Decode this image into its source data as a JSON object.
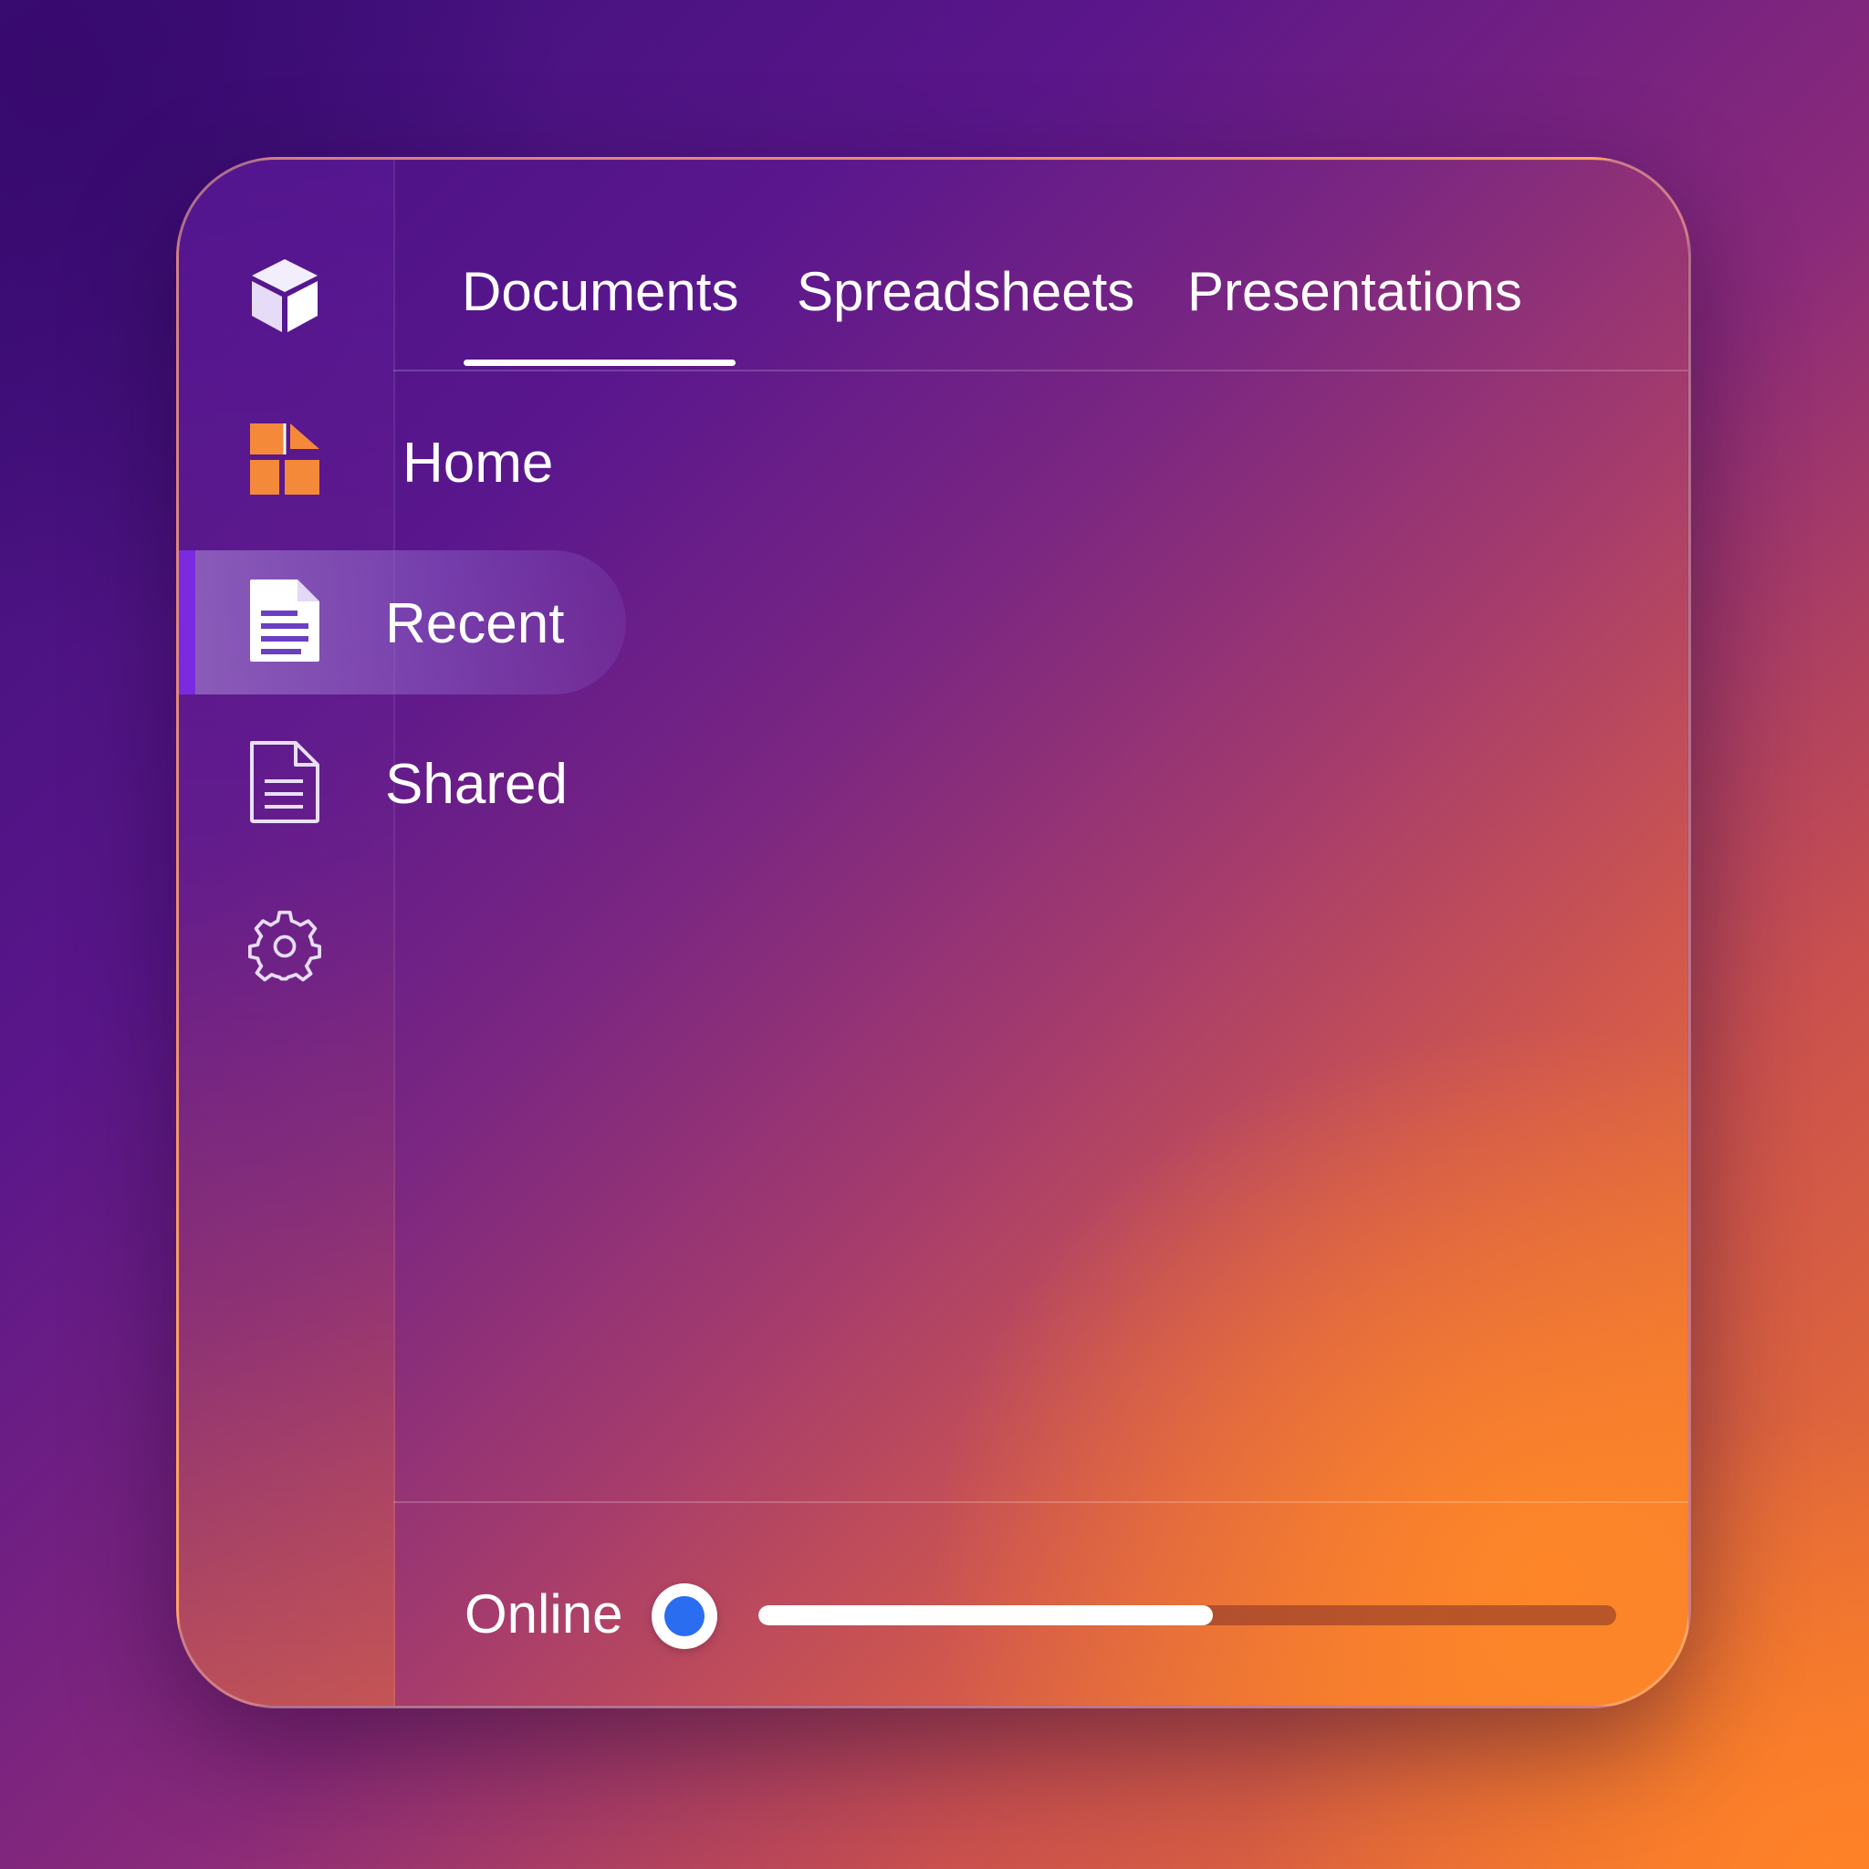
{
  "tabs": [
    {
      "label": "Documents",
      "active": true
    },
    {
      "label": "Spreadsheets",
      "active": false
    },
    {
      "label": "Presentations",
      "active": false
    }
  ],
  "sidebar": {
    "logo_icon": "cube-icon",
    "items": [
      {
        "label": "Home",
        "icon": "home-grid-icon",
        "selected": false
      },
      {
        "label": "Recent",
        "icon": "document-filled-icon",
        "selected": true
      },
      {
        "label": "Shared",
        "icon": "document-outline-icon",
        "selected": false
      }
    ],
    "settings_icon": "gear-icon"
  },
  "footer": {
    "status_label": "Online",
    "status_dot_color": "#2a6df0",
    "progress": 0.53
  },
  "colors": {
    "accent": "#7a2be0",
    "home_icon": "#f5893a",
    "track": "#a8503a"
  }
}
